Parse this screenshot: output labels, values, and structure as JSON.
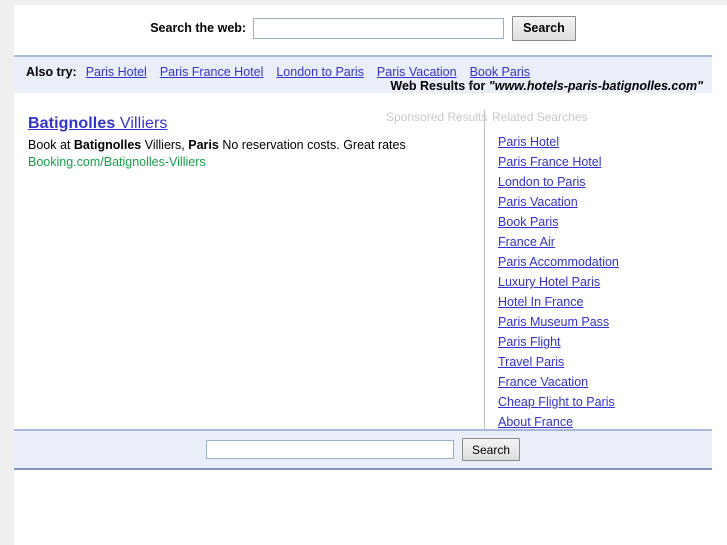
{
  "top_search": {
    "label": "Search the web:",
    "input_value": "",
    "input_placeholder": "",
    "button_label": "Search"
  },
  "also_try": {
    "label": "Also try:",
    "links": [
      "Paris Hotel",
      "Paris France Hotel",
      "London to Paris",
      "Paris Vacation",
      "Book Paris"
    ]
  },
  "web_results_heading": {
    "prefix": "Web Results for ",
    "query": "\"www.hotels-paris-batignolles.com\""
  },
  "columns": {
    "sponsored_header": "Sponsored Results",
    "related_header": "Related Searches"
  },
  "sponsored_result": {
    "title_bold": "Batignolles",
    "title_plain": " Villiers ",
    "description_pre": "Book at ",
    "description_b1": "Batignolles",
    "description_mid": " Villiers, ",
    "description_b2": "Paris",
    "description_post": " No reservation costs. Great rates",
    "url": "Booking.com/Batignolles-Villiers"
  },
  "related_searches": [
    "Paris Hotel",
    "Paris France Hotel",
    "London to Paris",
    "Paris Vacation",
    "Book Paris",
    "France Air",
    "Paris Accommodation",
    "Luxury Hotel Paris",
    "Hotel In France",
    "Paris Museum Pass",
    "Paris Flight",
    "Travel Paris",
    "France Vacation",
    "Cheap Flight to Paris",
    "About France"
  ],
  "bottom_search": {
    "input_value": "",
    "input_placeholder": "",
    "button_label": "Search"
  },
  "colors": {
    "page_background": "#efefef",
    "content_background": "#ffffff",
    "band_background": "#eaeef8",
    "band_border_top": "#a8b8d8",
    "band_border_bottom": "#7f93bb",
    "link": "#3333cc",
    "url_green": "#18a04a",
    "column_header_gray": "#c8c8c8",
    "input_border": "#9aafc4"
  }
}
